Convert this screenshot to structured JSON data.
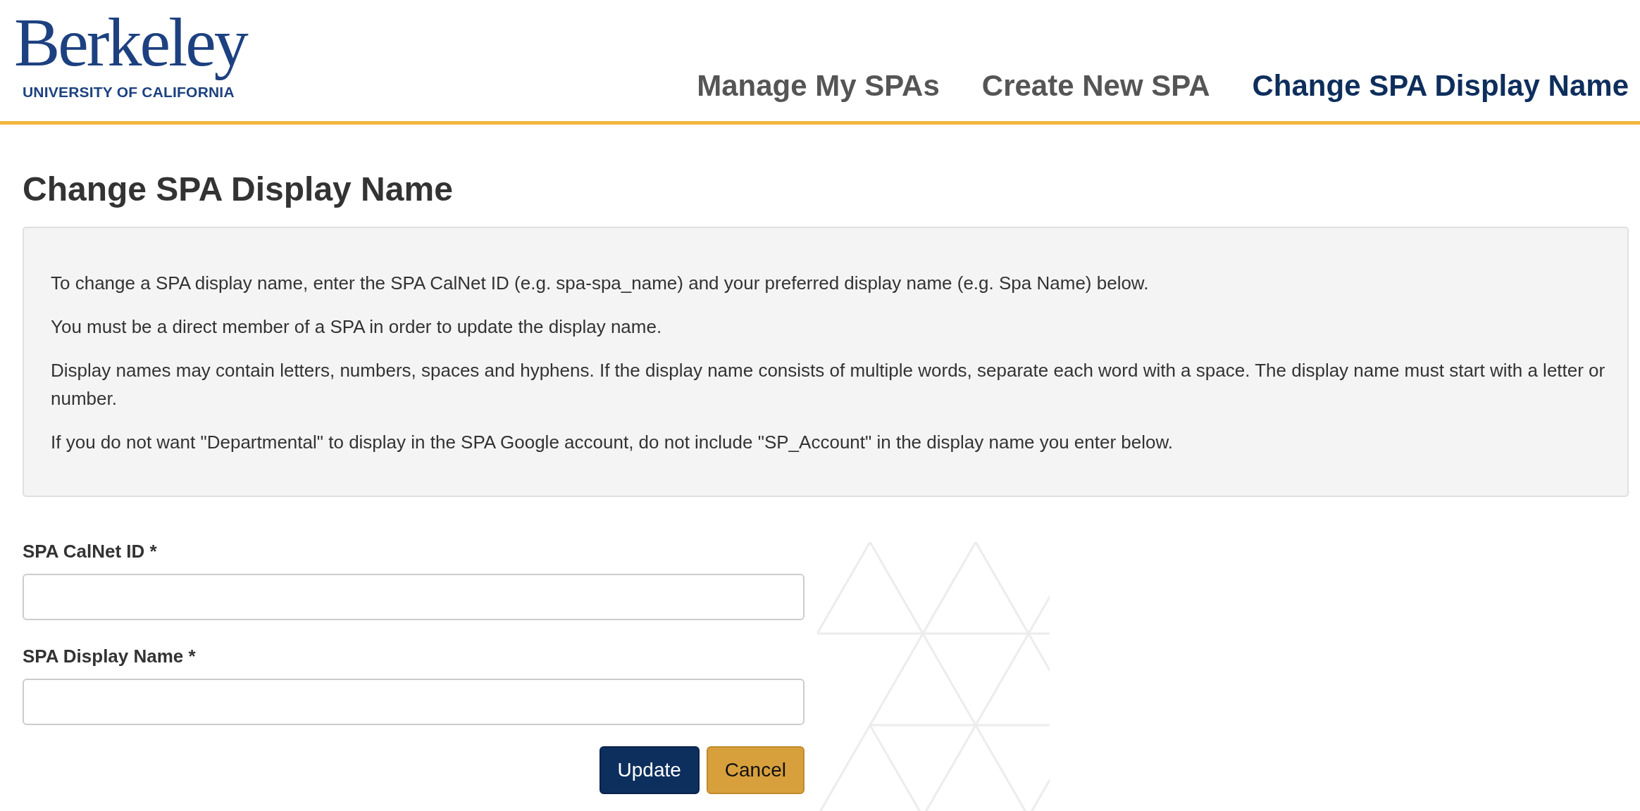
{
  "logo": {
    "wordmark": "Berkeley",
    "subtitle": "UNIVERSITY OF CALIFORNIA"
  },
  "nav": [
    {
      "label": "Manage My SPAs",
      "selected": false
    },
    {
      "label": "Create New SPA",
      "selected": false
    },
    {
      "label": "Change SPA Display Name",
      "selected": true
    }
  ],
  "page_title": "Change SPA Display Name",
  "info_paragraphs": [
    "To change a SPA display name, enter the SPA CalNet ID (e.g. spa-spa_name) and your preferred display name (e.g. Spa Name) below.",
    "You must be a direct member of a SPA in order to update the display name.",
    "Display names may contain letters, numbers, spaces and hyphens. If the display name consists of multiple words, separate each word with a space. The display name must start with a letter or number.",
    "If you do not want \"Departmental\" to display in the SPA Google account, do not include \"SP_Account\" in the display name you enter below."
  ],
  "fields": [
    {
      "label": "SPA CalNet ID *"
    },
    {
      "label": "SPA Display Name *"
    }
  ],
  "buttons": [
    {
      "label": "Update",
      "kind": "primary"
    },
    {
      "label": "Cancel",
      "kind": "secondary"
    }
  ]
}
